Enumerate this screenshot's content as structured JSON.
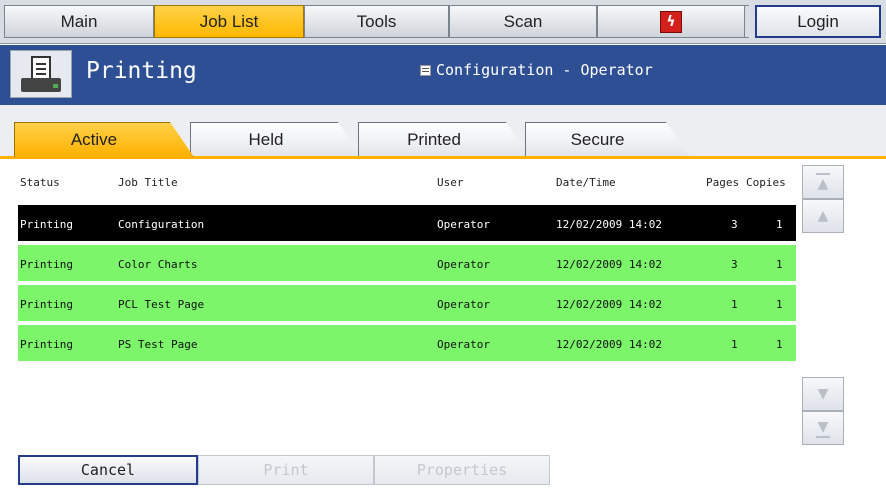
{
  "nav": {
    "main": "Main",
    "job_list": "Job List",
    "tools": "Tools",
    "scan": "Scan",
    "fiery_icon": "fiery-icon",
    "login": "Login"
  },
  "header": {
    "title": "Printing",
    "mode": "Configuration - Operator"
  },
  "tabs": [
    "Active",
    "Held",
    "Printed",
    "Secure"
  ],
  "table": {
    "columns": [
      "Status",
      "Job Title",
      "User",
      "Date/Time",
      "Pages",
      "Copies"
    ],
    "rows": [
      [
        "Printing",
        "Configuration",
        "Operator",
        "12/02/2009 14:02",
        "3",
        "1"
      ],
      [
        "Printing",
        "Color Charts",
        "Operator",
        "12/02/2009 14:02",
        "3",
        "1"
      ],
      [
        "Printing",
        "PCL Test Page",
        "Operator",
        "12/02/2009 14:02",
        "1",
        "1"
      ],
      [
        "Printing",
        "PS Test Page",
        "Operator",
        "12/02/2009 14:02",
        "1",
        "1"
      ]
    ]
  },
  "buttons": {
    "cancel": "Cancel",
    "print": "Print",
    "properties": "Properties"
  },
  "colors": {
    "accent": "#ffb800",
    "titlebar": "#2f4f95",
    "row_active": "#7cf56a",
    "row_selected": "#000000"
  }
}
